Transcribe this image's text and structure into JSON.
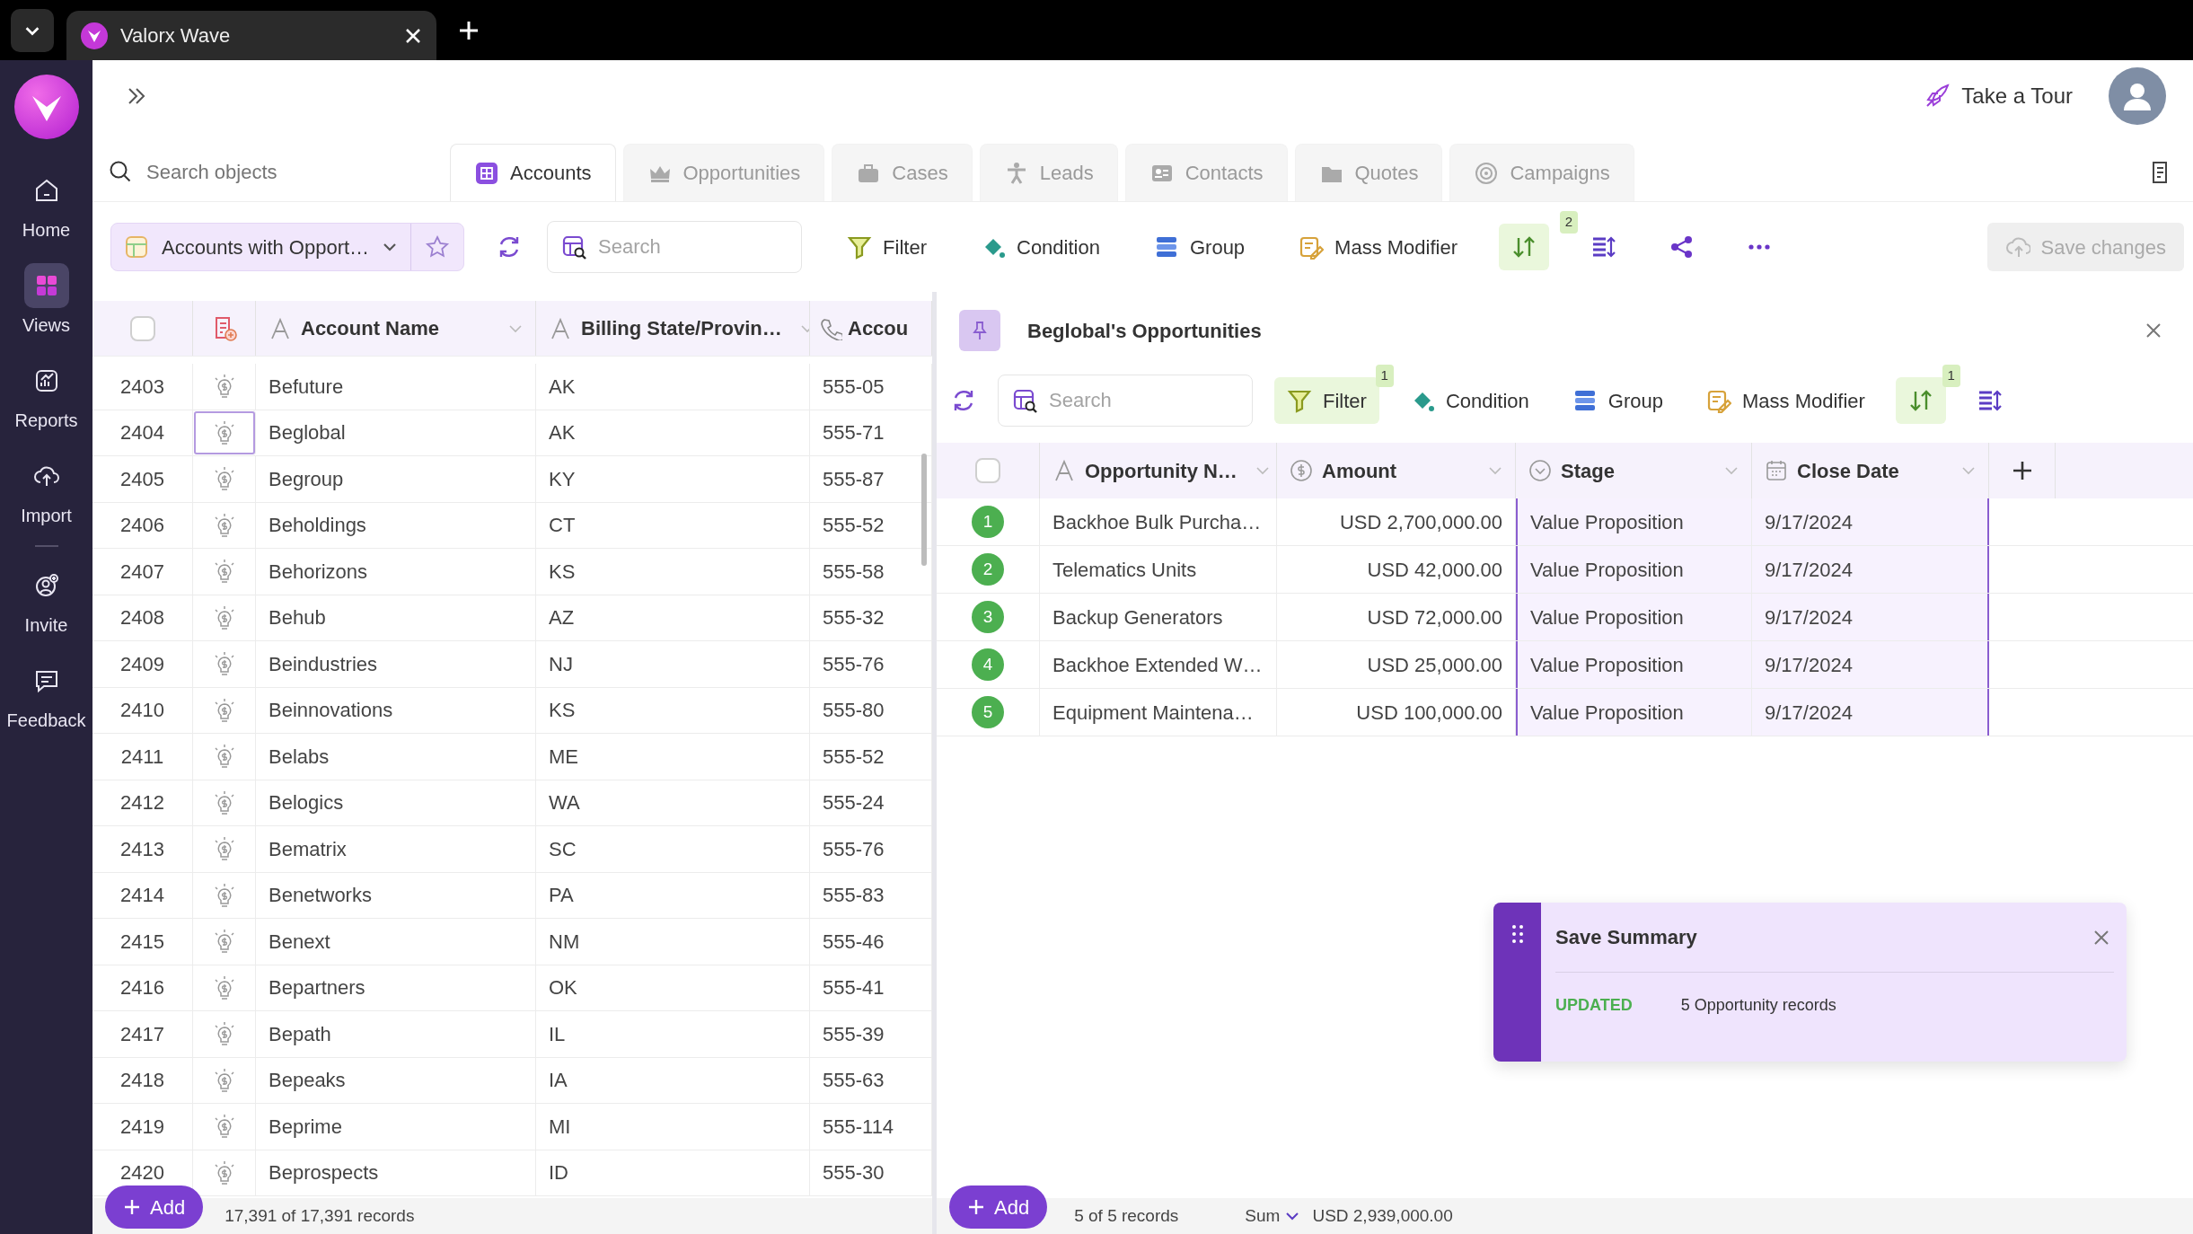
{
  "browser_tab": {
    "title": "Valorx Wave"
  },
  "sidebar": {
    "items": [
      {
        "label": "Home",
        "selected": false
      },
      {
        "label": "Views",
        "selected": true
      },
      {
        "label": "Reports",
        "selected": false
      },
      {
        "label": "Import",
        "selected": false
      },
      {
        "label": "Invite",
        "selected": false
      },
      {
        "label": "Feedback",
        "selected": false
      }
    ]
  },
  "header": {
    "tour": "Take a Tour"
  },
  "object_search": {
    "placeholder": "Search objects"
  },
  "object_tabs": [
    {
      "label": "Accounts",
      "selected": true
    },
    {
      "label": "Opportunities",
      "selected": false
    },
    {
      "label": "Cases",
      "selected": false
    },
    {
      "label": "Leads",
      "selected": false
    },
    {
      "label": "Contacts",
      "selected": false
    },
    {
      "label": "Quotes",
      "selected": false
    },
    {
      "label": "Campaigns",
      "selected": false
    }
  ],
  "toolbar": {
    "view": "Accounts with Opport…",
    "search_placeholder": "Search",
    "items": [
      {
        "kind": "filter",
        "label": "Filter",
        "active": false
      },
      {
        "kind": "condition",
        "label": "Condition",
        "active": false
      },
      {
        "kind": "group",
        "label": "Group",
        "active": false
      },
      {
        "kind": "mass",
        "label": "Mass Modifier",
        "active": false
      },
      {
        "kind": "sort",
        "active": true,
        "badge": "2"
      },
      {
        "kind": "columns",
        "active": false
      },
      {
        "kind": "share",
        "active": false
      },
      {
        "kind": "more",
        "active": false
      }
    ],
    "save": {
      "label": "Save changes",
      "disabled": true
    }
  },
  "accounts_table": {
    "select_all_checked": false,
    "columns": [
      "Account Name",
      "Billing State/Provin…",
      "Accou"
    ],
    "rows": [
      {
        "number": "2403",
        "name": "Befuture",
        "state": "AK",
        "phone": "555-05",
        "selected": false
      },
      {
        "number": "2404",
        "name": "Beglobal",
        "state": "AK",
        "phone": "555-71",
        "selected": true
      },
      {
        "number": "2405",
        "name": "Begroup",
        "state": "KY",
        "phone": "555-87",
        "selected": false
      },
      {
        "number": "2406",
        "name": "Beholdings",
        "state": "CT",
        "phone": "555-52",
        "selected": false
      },
      {
        "number": "2407",
        "name": "Behorizons",
        "state": "KS",
        "phone": "555-58",
        "selected": false
      },
      {
        "number": "2408",
        "name": "Behub",
        "state": "AZ",
        "phone": "555-32",
        "selected": false
      },
      {
        "number": "2409",
        "name": "Beindustries",
        "state": "NJ",
        "phone": "555-76",
        "selected": false
      },
      {
        "number": "2410",
        "name": "Beinnovations",
        "state": "KS",
        "phone": "555-80",
        "selected": false
      },
      {
        "number": "2411",
        "name": "Belabs",
        "state": "ME",
        "phone": "555-52",
        "selected": false
      },
      {
        "number": "2412",
        "name": "Belogics",
        "state": "WA",
        "phone": "555-24",
        "selected": false
      },
      {
        "number": "2413",
        "name": "Bematrix",
        "state": "SC",
        "phone": "555-76",
        "selected": false
      },
      {
        "number": "2414",
        "name": "Benetworks",
        "state": "PA",
        "phone": "555-83",
        "selected": false
      },
      {
        "number": "2415",
        "name": "Benext",
        "state": "NM",
        "phone": "555-46",
        "selected": false
      },
      {
        "number": "2416",
        "name": "Bepartners",
        "state": "OK",
        "phone": "555-41",
        "selected": false
      },
      {
        "number": "2417",
        "name": "Bepath",
        "state": "IL",
        "phone": "555-39",
        "selected": false
      },
      {
        "number": "2418",
        "name": "Bepeaks",
        "state": "IA",
        "phone": "555-63",
        "selected": false
      },
      {
        "number": "2419",
        "name": "Beprime",
        "state": "MI",
        "phone": "555-114",
        "selected": false
      },
      {
        "number": "2420",
        "name": "Beprospects",
        "state": "ID",
        "phone": "555-30",
        "selected": false
      }
    ],
    "footer": {
      "add": "Add",
      "records": "17,391 of 17,391 records"
    }
  },
  "panel": {
    "title": "Beglobal's Opportunities",
    "search_placeholder": "Search",
    "items": [
      {
        "kind": "filter",
        "label": "Filter",
        "active": true,
        "badge": "1"
      },
      {
        "kind": "condition",
        "label": "Condition",
        "active": false
      },
      {
        "kind": "group",
        "label": "Group",
        "active": false
      },
      {
        "kind": "mass",
        "label": "Mass Modifier",
        "active": false
      },
      {
        "kind": "sort",
        "active": true,
        "badge": "1"
      },
      {
        "kind": "columns",
        "active": false
      }
    ],
    "select_all_checked": false,
    "columns": [
      "Opportunity N…",
      "Amount",
      "Stage",
      "Close Date"
    ],
    "rows": [
      {
        "index": "1",
        "name": "Backhoe Bulk Purcha…",
        "amount": "USD 2,700,000.00",
        "stage": "Value Proposition",
        "close_date": "9/17/2024",
        "selected": true
      },
      {
        "index": "2",
        "name": "Telematics Units",
        "amount": "USD 42,000.00",
        "stage": "Value Proposition",
        "close_date": "9/17/2024",
        "selected": true
      },
      {
        "index": "3",
        "name": "Backup Generators",
        "amount": "USD 72,000.00",
        "stage": "Value Proposition",
        "close_date": "9/17/2024",
        "selected": true
      },
      {
        "index": "4",
        "name": "Backhoe Extended W…",
        "amount": "USD 25,000.00",
        "stage": "Value Proposition",
        "close_date": "9/17/2024",
        "selected": true
      },
      {
        "index": "5",
        "name": "Equipment Maintena…",
        "amount": "USD 100,000.00",
        "stage": "Value Proposition",
        "close_date": "9/17/2024",
        "selected": true
      }
    ],
    "footer": {
      "add": "Add",
      "records": "5 of 5 records",
      "sum_label": "Sum",
      "sum": "USD 2,939,000.00"
    }
  },
  "toast": {
    "title": "Save Summary",
    "status": "UPDATED",
    "message": "5 Opportunity records"
  }
}
